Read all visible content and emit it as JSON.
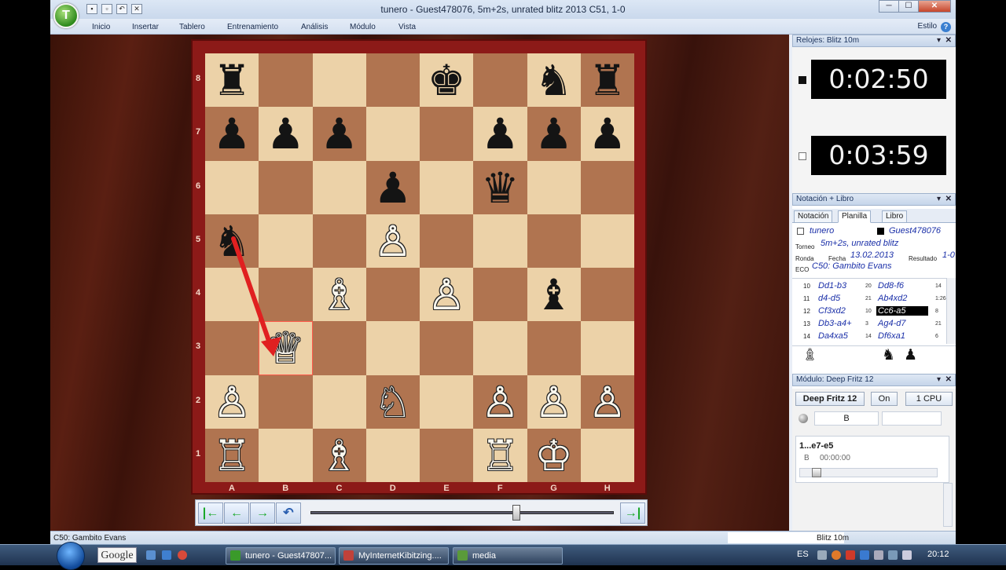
{
  "window": {
    "title": "tunero - Guest478076, 5m+2s, unrated blitz 2013  C51, 1-0",
    "orb_letter": "T",
    "min": "─",
    "max": "☐",
    "close": "✕"
  },
  "menu": {
    "items": [
      "Inicio",
      "Insertar",
      "Tablero",
      "Entrenamiento",
      "Análisis",
      "Módulo",
      "Vista"
    ],
    "style": "Estilo",
    "help": "?"
  },
  "board": {
    "ranks": [
      "8",
      "7",
      "6",
      "5",
      "4",
      "3",
      "2",
      "1"
    ],
    "files": [
      "A",
      "B",
      "C",
      "D",
      "E",
      "F",
      "G",
      "H"
    ],
    "squares": [
      [
        "♜",
        "",
        "",
        "",
        "♚",
        "",
        "♞",
        "♜"
      ],
      [
        "♟",
        "♟",
        "♟",
        "",
        "",
        "♟",
        "♟",
        "♟"
      ],
      [
        "",
        "",
        "",
        "♟",
        "",
        "♛",
        "",
        ""
      ],
      [
        "♞",
        "",
        "",
        "♙",
        "",
        "",
        "",
        ""
      ],
      [
        "",
        "",
        "♗",
        "",
        "♙",
        "",
        "♝",
        ""
      ],
      [
        "",
        "♕",
        "",
        "",
        "",
        "",
        "",
        ""
      ],
      [
        "♙",
        "",
        "",
        "♘",
        "",
        "♙",
        "♙",
        "♙"
      ],
      [
        "♖",
        "",
        "♗",
        "",
        "",
        "♖",
        "♔",
        ""
      ]
    ],
    "colors": [
      [
        "b",
        "",
        "",
        "",
        "b",
        "",
        "b",
        "b"
      ],
      [
        "b",
        "b",
        "b",
        "",
        "",
        "b",
        "b",
        "b"
      ],
      [
        "",
        "",
        "",
        "b",
        "",
        "b",
        "",
        ""
      ],
      [
        "b",
        "",
        "",
        "w",
        "",
        "",
        "",
        ""
      ],
      [
        "",
        "",
        "w",
        "",
        "w",
        "",
        "b",
        ""
      ],
      [
        "",
        "w",
        "",
        "",
        "",
        "",
        "",
        ""
      ],
      [
        "w",
        "",
        "",
        "w",
        "",
        "w",
        "w",
        "w"
      ],
      [
        "w",
        "",
        "w",
        "",
        "",
        "w",
        "w",
        ""
      ]
    ],
    "arrow_color": "#e02020"
  },
  "nav": {
    "first": "|←",
    "prev": "←",
    "next": "→",
    "undo": "↶",
    "last": "→|",
    "position": 0.68
  },
  "clocks": {
    "title": "Relojes: Blitz 10m",
    "top": "0:02:50",
    "bottom": "0:03:59"
  },
  "notation": {
    "title": "Notación + Libro",
    "tabs": [
      "Notación",
      "Planilla",
      "Libro"
    ],
    "white": "tunero",
    "black": "Guest478076",
    "torneo_label": "Torneo",
    "torneo": "5m+2s, unrated blitz",
    "ronda_label": "Ronda",
    "fecha_label": "Fecha",
    "fecha": "13.02.2013",
    "resultado_label": "Resultado",
    "resultado": "1-0",
    "eco_label": "ECO",
    "eco": "C50: Gambito Evans",
    "moves": [
      {
        "n": "10",
        "w": "Dd1-b3",
        "t1": "20",
        "b": "Dd8-f6",
        "t2": "14",
        "sel": false
      },
      {
        "n": "11",
        "w": "d4-d5",
        "t1": "21",
        "b": "Ab4xd2",
        "t2": "1:26",
        "sel": false
      },
      {
        "n": "12",
        "w": "Cf3xd2",
        "t1": "10",
        "b": "Cc6-a5",
        "t2": "8",
        "sel": true
      },
      {
        "n": "13",
        "w": "Db3-a4+",
        "t1": "3",
        "b": "Ag4-d7",
        "t2": "21",
        "sel": false
      },
      {
        "n": "14",
        "w": "Da4xa5",
        "t1": "14",
        "b": "Df6xa1",
        "t2": "6",
        "sel": false
      }
    ],
    "captured": [
      "♗",
      "♞",
      "♟"
    ]
  },
  "engine": {
    "title": "Módulo: Deep Fritz 12",
    "name": "Deep Fritz 12",
    "on": "On",
    "cpu": "1 CPU",
    "eval": "B",
    "line": "1...e7-e5",
    "line_sub": "B",
    "line_time": "00:00:00"
  },
  "status": {
    "left": "C50: Gambito Evans",
    "right": "Blitz 10m"
  },
  "taskbar": {
    "google": "Google",
    "tasks": [
      "tunero - Guest47807...",
      "MyInternetKibitzing....",
      "media"
    ],
    "lang": "ES",
    "time": "20:12"
  }
}
